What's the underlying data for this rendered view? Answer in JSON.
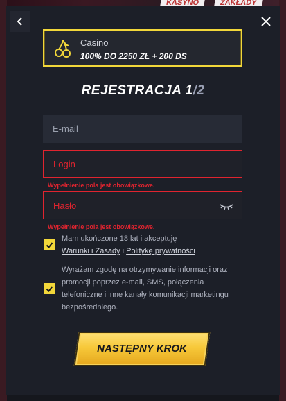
{
  "background": {
    "label_casino": "KASYNO",
    "label_bets": "ZAKŁADY"
  },
  "promo": {
    "kind": "Casino",
    "offer": "100% DO 2250 ZŁ + 200 DS"
  },
  "title": {
    "text": "REJESTRACJA 1",
    "sep": "/",
    "total": "2"
  },
  "fields": {
    "email": {
      "placeholder": "E-mail"
    },
    "login": {
      "placeholder": "Login",
      "error": "Wypełnienie pola jest obowiązkowe."
    },
    "password": {
      "placeholder": "Hasło",
      "error": "Wypełnienie pola jest obowiązkowe."
    }
  },
  "consents": {
    "terms": {
      "text_1": "Mam ukończone 18 lat i akceptuję",
      "link_1": "Warunki i Zasady",
      "sep": " i ",
      "link_2": "Politykę prywatności",
      "checked": true
    },
    "marketing": {
      "text": "Wyrażam zgodę na otrzymywanie informacji oraz promocji poprzez e-mail, SMS, połączenia telefoniczne i inne kanały komunikacji marketingu bezpośredniego.",
      "checked": true
    }
  },
  "cta": {
    "label": "NASTĘPNY KROK"
  },
  "colors": {
    "accent": "#f2d73a",
    "error": "#e0242f",
    "panel": "#1c1f28"
  }
}
